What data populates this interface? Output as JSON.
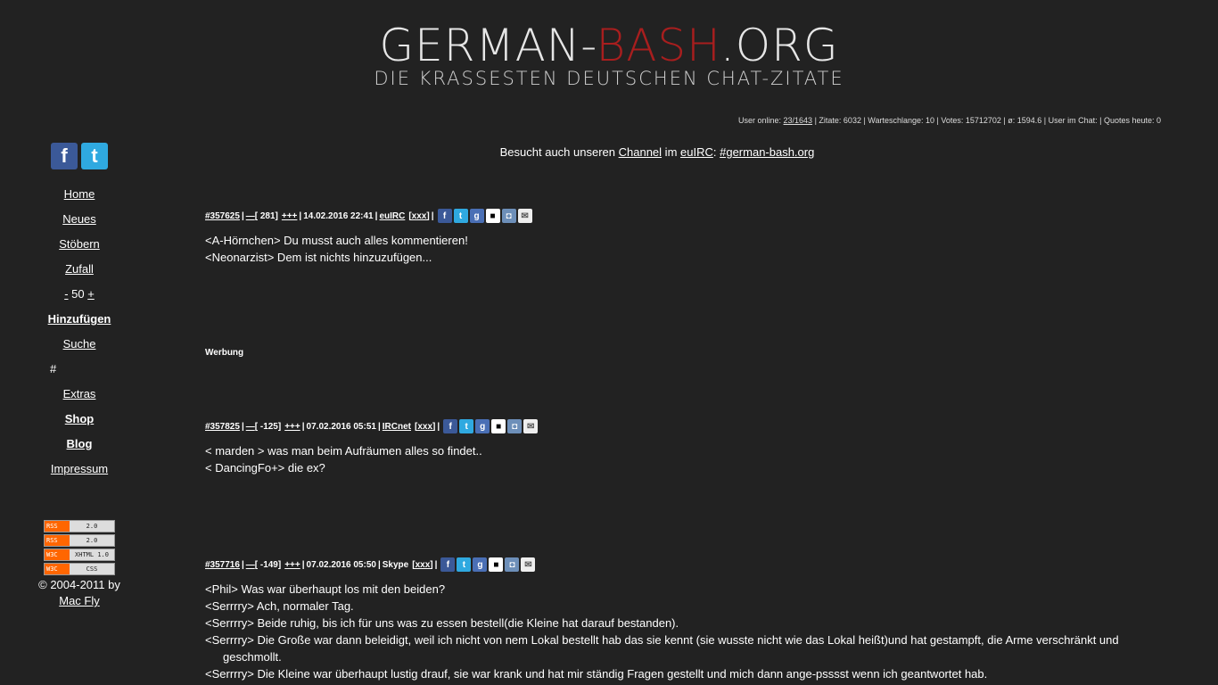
{
  "logo": {
    "part1": "GERMAN-",
    "part2": "BASH",
    "part3": ".ORG",
    "subtitle": "DIE KRASSESTEN DEUTSCHEN CHAT-ZITATE"
  },
  "stats": {
    "prefix": "User online: ",
    "online_link": "23/1643",
    "rest": " | Zitate: 6032 | Warteschlange: 10 | Votes: 15712702 | ø: 1594.6 | User im Chat: | Quotes heute: 0"
  },
  "channel": {
    "pre": "Besucht auch unseren ",
    "channel_link": "Channel",
    "mid": " im ",
    "network_link": "euIRC",
    "colon": ": ",
    "chan_link": "#german-bash.org"
  },
  "sidebar": {
    "facebook": "f",
    "twitter": "t",
    "nav": {
      "home": "Home",
      "neues": "Neues",
      "stoebern": "Stöbern",
      "zufall": "Zufall",
      "minus": "-",
      "fifty": " 50 ",
      "plus": "+",
      "hinzufuegen": "Hinzufügen",
      "suche": "Suche",
      "hash": "#",
      "extras": "Extras",
      "shop": "Shop",
      "blog": "Blog",
      "impressum": "Impressum"
    },
    "badges": [
      {
        "l": "RSS",
        "r": "2.0"
      },
      {
        "l": "RSS",
        "r": "2.0"
      },
      {
        "l": "W3C",
        "r": "XHTML 1.0"
      },
      {
        "l": "W3C",
        "r": "CSS"
      }
    ],
    "copyright": "© 2004-2011 by",
    "author": "Mac Fly"
  },
  "werbung": "Werbung",
  "quotes": [
    {
      "id": "#357625",
      "minus": "—",
      "score": "[ 281]",
      "plus": "+++",
      "date": "14.02.2016 22:41",
      "net": "euIRC",
      "xxx": "[xxx]",
      "lines": [
        "<A-Hörnchen> Du musst auch alles kommentieren!",
        "<Neonarzist> Dem ist nichts hinzuzufügen..."
      ]
    },
    {
      "id": "#357825",
      "minus": "—",
      "score": "[ -125]",
      "plus": "+++",
      "date": "07.02.2016 05:51",
      "net": "IRCnet",
      "xxx": "[xxx]",
      "lines": [
        "< marden > was man beim Aufräumen alles so findet..",
        "< DancingFo+> die ex?"
      ]
    },
    {
      "id": "#357716",
      "minus": "—",
      "score": "[ -149]",
      "plus": "+++",
      "date": "07.02.2016 05:50",
      "net": "Skype",
      "xxx": "[xxx]",
      "lines": [
        "<Phil> Was war überhaupt los mit den beiden?",
        "<Serrrry> Ach, normaler Tag.",
        "<Serrrry> Beide ruhig, bis ich für uns was zu essen bestell(die Kleine hat darauf bestanden).",
        "<Serrrry> Die Große war dann beleidigt, weil ich nicht von nem Lokal bestellt hab das sie kennt (sie wusste nicht wie das Lokal heißt)und hat gestampft, die Arme verschränkt und",
        "geschmollt.",
        "<Serrrry> Die Kleine war überhaupt lustig drauf, sie war krank und hat mir ständig Fragen gestellt und mich dann ange-psssst wenn ich geantwortet hab."
      ]
    }
  ],
  "share_icons": [
    "facebook-icon",
    "twitter-icon",
    "google-icon",
    "delicious-icon",
    "mister-wong-icon",
    "mail-icon"
  ]
}
